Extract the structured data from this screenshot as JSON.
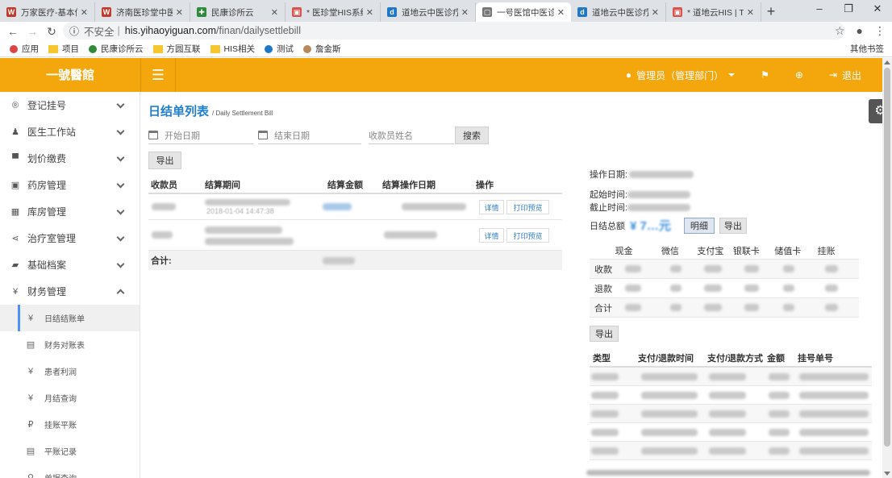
{
  "browser": {
    "tabs": [
      {
        "title": "万家医疗-基本信息",
        "icon": "wps-icon",
        "color": "#c23a2b",
        "glyph": "W"
      },
      {
        "title": "济南医珍堂中医诊所",
        "icon": "wps-icon",
        "color": "#c23a2b",
        "glyph": "W"
      },
      {
        "title": "民康诊所云",
        "icon": "minkang-icon",
        "color": "#2e8b3a",
        "glyph": "✚"
      },
      {
        "title": "* 医珍堂HIS系统设计",
        "icon": "his-icon",
        "color": "#d9534f",
        "glyph": "▣"
      },
      {
        "title": "道地云中医诊疗管理",
        "icon": "daodi-icon",
        "color": "#1f77c7",
        "glyph": "d"
      },
      {
        "title": "一号医馆中医诊疗",
        "icon": "page-icon",
        "color": "#777777",
        "glyph": "▢",
        "active": true
      },
      {
        "title": "道地云中医诊疗管理",
        "icon": "daodi-icon",
        "color": "#1f77c7",
        "glyph": "d"
      },
      {
        "title": "* 道地云HIS | Trello",
        "icon": "his-icon",
        "color": "#d9534f",
        "glyph": "▣"
      }
    ],
    "new_tab": "+",
    "insecure_label": "不安全",
    "separator": "|",
    "url_host": "his.yihaoyiguan.com",
    "url_path": "/finan/dailysettlebill",
    "bookmarks": [
      {
        "label": "应用",
        "icon": "apps-icon"
      },
      {
        "label": "项目",
        "icon": "folder-icon"
      },
      {
        "label": "民康诊所云",
        "icon": "minkang-icon"
      },
      {
        "label": "方圆互联",
        "icon": "folder-icon"
      },
      {
        "label": "HIS相关",
        "icon": "folder-icon"
      },
      {
        "label": "测试",
        "icon": "daodi-icon"
      },
      {
        "label": "詹金斯",
        "icon": "jenkins-icon"
      }
    ],
    "other_bookmarks": "其他书签"
  },
  "header": {
    "logo": "一號醫館",
    "user": "管理员（管理部门）",
    "logout": "退出"
  },
  "sidebar": {
    "items": [
      {
        "label": "登记挂号",
        "icon": "registered-icon",
        "glyph": "®"
      },
      {
        "label": "医生工作站",
        "icon": "user-md-icon",
        "glyph": "♟"
      },
      {
        "label": "划价缴费",
        "icon": "cart-icon",
        "glyph": "▀"
      },
      {
        "label": "药房管理",
        "icon": "pharmacy-icon",
        "glyph": "▣"
      },
      {
        "label": "库房管理",
        "icon": "warehouse-icon",
        "glyph": "▦"
      },
      {
        "label": "治疗室管理",
        "icon": "share-icon",
        "glyph": "⋖"
      },
      {
        "label": "基础档案",
        "icon": "book-icon",
        "glyph": "▰"
      },
      {
        "label": "财务管理",
        "icon": "yen-icon",
        "glyph": "¥"
      }
    ],
    "finance_sub": [
      {
        "label": "日结结账单",
        "icon": "yen-icon",
        "glyph": "¥",
        "active": true
      },
      {
        "label": "财务对账表",
        "icon": "doc-icon",
        "glyph": "▤"
      },
      {
        "label": "患者利润",
        "icon": "yen-icon",
        "glyph": "¥"
      },
      {
        "label": "月结查询",
        "icon": "yen-icon",
        "glyph": "¥"
      },
      {
        "label": "挂账平账",
        "icon": "balance-icon",
        "glyph": "₽"
      },
      {
        "label": "平账记录",
        "icon": "doc-icon",
        "glyph": "▤"
      },
      {
        "label": "单据查询",
        "icon": "search-icon",
        "glyph": "⚲"
      }
    ]
  },
  "page": {
    "title": "日结单列表",
    "subtitle": "/ Daily Settlement Bill",
    "start_placeholder": "开始日期",
    "end_placeholder": "结束日期",
    "cashier_placeholder": "收款员姓名",
    "search": "搜索",
    "export": "导出",
    "table_headers": [
      "收款员",
      "结算期间",
      "结算金额",
      "结算操作日期",
      "操作"
    ],
    "row_visible_text": "2018-01-04 14:47:38",
    "detail": "详情",
    "print_preview": "打印预览",
    "total_label": "合计:"
  },
  "right_panel": {
    "op_date_label": "操作日期:",
    "start_label": "起始时间:",
    "end_label": "截止时间:",
    "daily_total_label": "日结总额",
    "amount_visible": "¥ 7…元",
    "detail_btn": "明细",
    "export_btn": "导出",
    "pay_headers": [
      "现金",
      "微信",
      "支付宝",
      "银联卡",
      "储值卡",
      "挂账"
    ],
    "pay_rows": [
      "收款",
      "退款",
      "合计"
    ],
    "export2": "导出",
    "record_headers": [
      "类型",
      "支付/退款时间",
      "支付/退款方式",
      "金额",
      "挂号单号"
    ]
  }
}
